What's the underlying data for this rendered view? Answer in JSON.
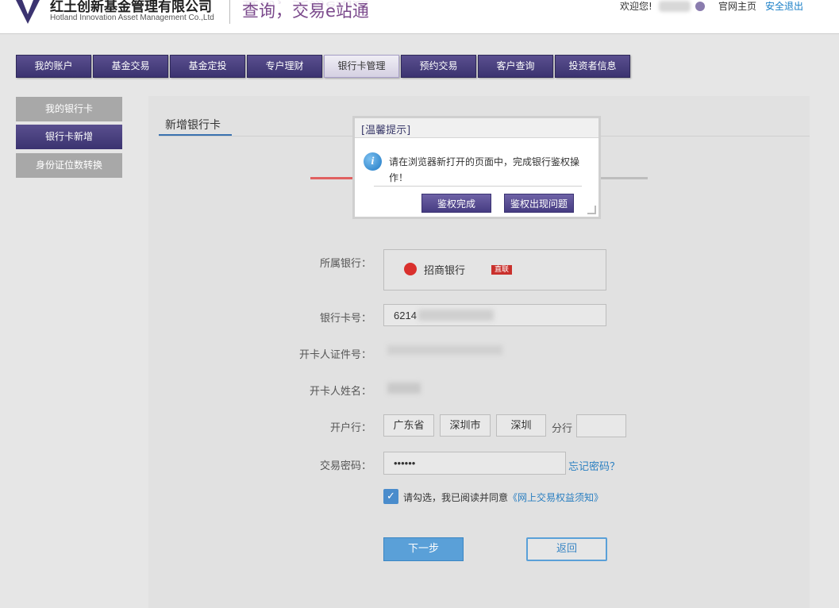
{
  "header": {
    "company_cn": "红土创新基金管理有限公司",
    "company_en": "Hotland Innovation Asset Management Co.,Ltd",
    "slogan": "查询，交易e站通",
    "welcome": "欢迎您!",
    "home_link": "官网主页",
    "logout_link": "安全退出"
  },
  "nav": {
    "items": [
      {
        "label": "我的账户"
      },
      {
        "label": "基金交易"
      },
      {
        "label": "基金定投"
      },
      {
        "label": "专户理财"
      },
      {
        "label": "银行卡管理"
      },
      {
        "label": "预约交易"
      },
      {
        "label": "客户查询"
      },
      {
        "label": "投资者信息"
      }
    ],
    "active_index": 4
  },
  "sidebar": {
    "items": [
      {
        "label": "我的银行卡"
      },
      {
        "label": "银行卡新增"
      },
      {
        "label": "身份证位数转换"
      }
    ],
    "active_index": 1
  },
  "main": {
    "tab_title": "新增银行卡",
    "form": {
      "bank_label": "所属银行：",
      "bank_name": "招商银行",
      "bank_badge": "直联",
      "card_label": "银行卡号：",
      "card_value": "6214",
      "id_label": "开卡人证件号：",
      "name_label": "开卡人姓名：",
      "branch_label": "开户行：",
      "province": "广东省",
      "city": "深圳市",
      "district": "深圳",
      "branch_suffix": "分行",
      "password_label": "交易密码：",
      "password_value": "••••••",
      "forgot_link": "忘记密码？",
      "agree_text": "请勾选，我已阅读并同意",
      "agree_link": "《网上交易权益须知》",
      "next_button": "下一步",
      "back_button": "返回"
    }
  },
  "dialog": {
    "title": "[温馨提示]",
    "message": "请在浏览器新打开的页面中，完成银行鉴权操作！",
    "btn_done": "鉴权完成",
    "btn_problem": "鉴权出现问题"
  },
  "colors": {
    "nav_purple": "#463c82",
    "link_blue": "#2a7fc1",
    "primary_button": "#5aa0d8",
    "bank_red": "#d9302d"
  }
}
